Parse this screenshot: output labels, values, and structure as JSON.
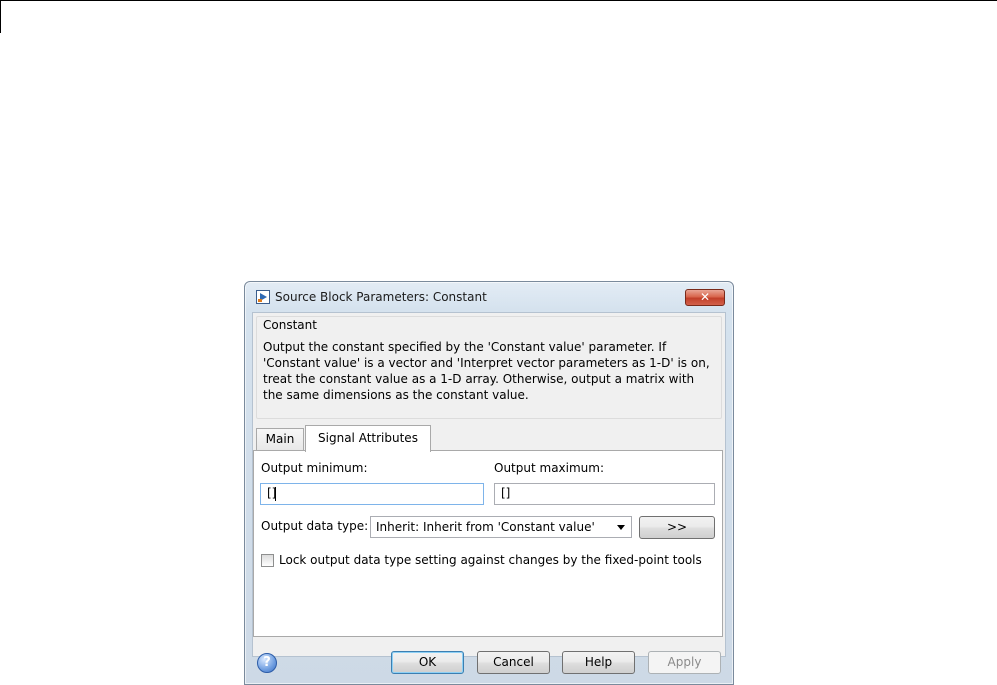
{
  "window": {
    "title": "Source Block Parameters: Constant",
    "close_glyph": "✕"
  },
  "description": {
    "group_title": "Constant",
    "text": "Output the constant specified by the 'Constant value' parameter. If 'Constant value' is a vector and 'Interpret vector parameters as 1-D' is on, treat the constant value as a 1-D array. Otherwise, output a matrix with the same dimensions as the constant value."
  },
  "tabs": [
    {
      "label": "Main",
      "selected": false
    },
    {
      "label": "Signal Attributes",
      "selected": true
    }
  ],
  "signal_attributes": {
    "output_minimum": {
      "label": "Output minimum:",
      "value": "[]"
    },
    "output_maximum": {
      "label": "Output maximum:",
      "value": "[]"
    },
    "output_data_type": {
      "label": "Output data type:",
      "selected": "Inherit: Inherit from 'Constant value'",
      "assistant_button": ">>"
    },
    "lock_checkbox": {
      "label": "Lock output data type setting against changes by the fixed-point tools",
      "checked": false
    }
  },
  "footer": {
    "help_glyph": "?",
    "ok_label": "OK",
    "cancel_label": "Cancel",
    "help_label": "Help",
    "apply_label": "Apply"
  },
  "colors": {
    "frame": "#d5e2ee",
    "close_button": "#c2402a",
    "default_button_border": "#3c7fb1"
  },
  "icons": {
    "app": "simulink-block-icon",
    "close": "close-icon",
    "help": "help-icon",
    "dropdown": "chevron-down-icon"
  }
}
